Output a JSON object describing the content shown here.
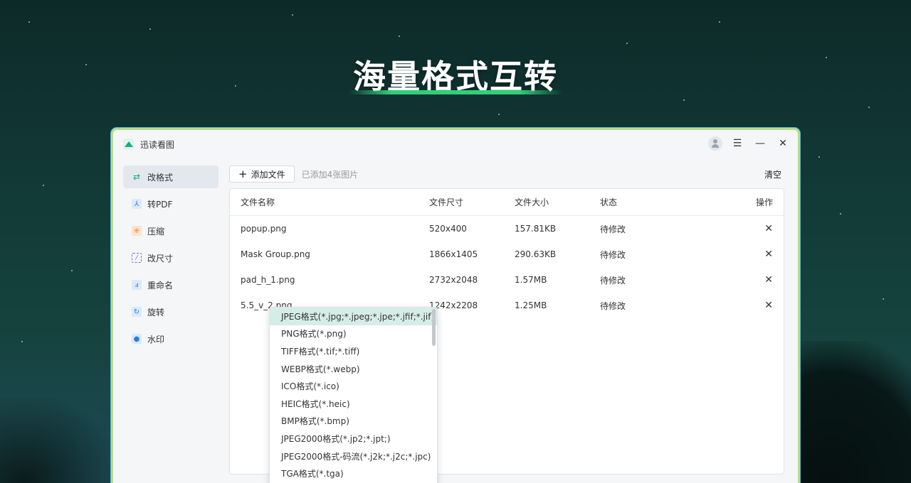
{
  "hero": {
    "title": "海量格式互转"
  },
  "app": {
    "name": "迅读看图"
  },
  "sidebar": {
    "items": [
      {
        "label": "改格式",
        "icon": "swap-icon"
      },
      {
        "label": "转PDF",
        "icon": "pdf-icon"
      },
      {
        "label": "压缩",
        "icon": "compress-icon"
      },
      {
        "label": "改尺寸",
        "icon": "resize-icon"
      },
      {
        "label": "重命名",
        "icon": "rename-icon"
      },
      {
        "label": "旋转",
        "icon": "rotate-icon"
      },
      {
        "label": "水印",
        "icon": "watermark-icon"
      }
    ]
  },
  "toolbar": {
    "add_label": "添加文件",
    "added_text": "已添加4张图片",
    "clear_label": "清空"
  },
  "table": {
    "headers": [
      "文件名称",
      "文件尺寸",
      "文件大小",
      "状态",
      "操作"
    ],
    "rows": [
      {
        "name": "popup.png",
        "dims": "520x400",
        "size": "157.81KB",
        "status": "待修改"
      },
      {
        "name": "Mask Group.png",
        "dims": "1866x1405",
        "size": "290.63KB",
        "status": "待修改"
      },
      {
        "name": "pad_h_1.png",
        "dims": "2732x2048",
        "size": "1.57MB",
        "status": "待修改"
      },
      {
        "name": "5.5_v_2.png",
        "dims": "1242x2208",
        "size": "1.25MB",
        "status": "待修改"
      }
    ]
  },
  "format_dropdown": {
    "options": [
      "JPEG格式(*.jpg;*.jpeg;*.jpe;*.jfif;*.jif)",
      "PNG格式(*.png)",
      "TIFF格式(*.tif;*.tiff)",
      "WEBP格式(*.webp)",
      "ICO格式(*.ico)",
      "HEIC格式(*.heic)",
      "BMP格式(*.bmp)",
      "JPEG2000格式(*.jp2;*.jpt;)",
      "JPEG2000格式-码流(*.j2k;*.j2c;*.jpc)",
      "TGA格式(*.tga)"
    ],
    "selected_index": 0
  },
  "colors": {
    "accent": "#19a889",
    "selected_bg": "#d6ede7",
    "window_border": "#b7dc8a"
  }
}
